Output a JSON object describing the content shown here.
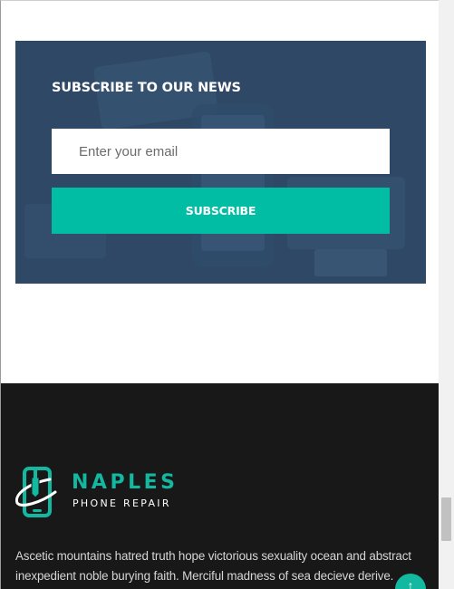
{
  "newsletter": {
    "title": "SUBSCRIBE TO OUR NEWS",
    "email_placeholder": "Enter your email",
    "subscribe_label": "SUBSCRIBE"
  },
  "footer": {
    "brand_name": "NAPLES",
    "brand_subtitle": "PHONE REPAIR",
    "description": "Ascetic mountains hatred truth hope victorious sexuality ocean and abstract inexpedient noble burying faith. Merciful madness of sea decieve derive.",
    "scroll_top_icon": "arrow-up-icon"
  },
  "colors": {
    "accent": "#00bda4",
    "newsletter_overlay": "#2b4461",
    "footer_bg": "#181818",
    "brand_teal": "#12b8a0"
  },
  "scrollbar": {
    "position": "near-bottom"
  }
}
